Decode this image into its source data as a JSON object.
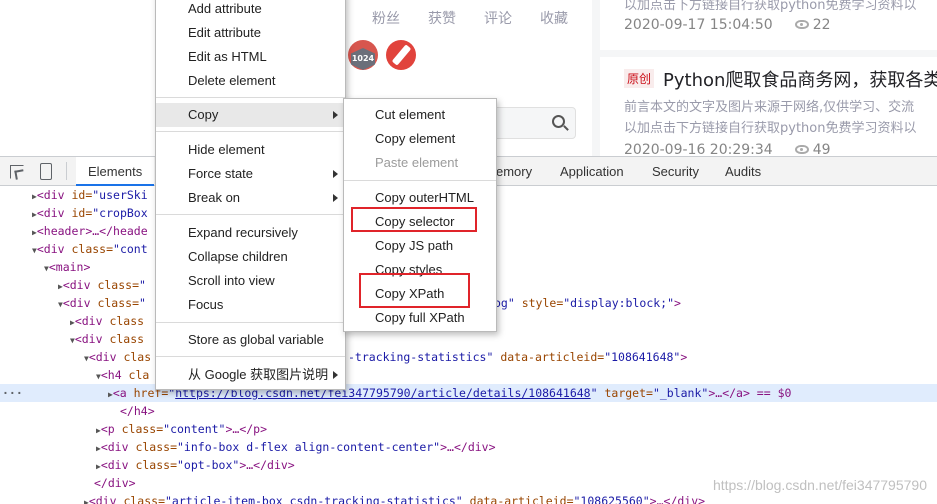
{
  "webpage": {
    "stats": [
      "粉丝",
      "获赞",
      "评论",
      "收藏"
    ],
    "badges": {
      "year_badge": "1024"
    },
    "right_panel": {
      "post1_excerpt": "以加点击下方链接自行获取python免费学习资料以",
      "post1_date": "2020-09-17 15:04:50",
      "post1_views": "22",
      "post2_badge": "原创",
      "post2_title": "Python爬取食品商务网，获取各类",
      "post2_excerpt1": "前言本文的文字及图片来源于网络,仅供学习、交流",
      "post2_excerpt2": "以加点击下方链接自行获取python免费学习资料以",
      "post2_date": "2020-09-16 20:29:34",
      "post2_views": "49"
    }
  },
  "devtools": {
    "tabs": {
      "elements": "Elements",
      "memory": "emory",
      "application": "Application",
      "security": "Security",
      "audits": "Audits"
    },
    "dom": {
      "l1_a": "div",
      "l1_attr": " id=",
      "l1_val": "\"userSki",
      "l2_a": "div",
      "l2_attr": " id=",
      "l2_val": "\"cropBox",
      "l3": "header",
      "l3_rest": "…</heade",
      "l4_a": "div",
      "l4_attr": " class=",
      "l4_val": "\"cont",
      "l5": "main",
      "l6_attr": " class=",
      "l6_val": "\"",
      "l7_attr": " class=",
      "l7_val": "\"",
      "l7_tail_val": "og\"",
      "l7_tail_attr": " style=",
      "l7_tail_val2": "\"display:block;\"",
      "l8_attr": " class",
      "l9_attr": " class",
      "l10_attr": " clas",
      "l10_val": "-tracking-statistics\"",
      "l10_attr2": " data-articleid=",
      "l10_val2": "\"108641648\"",
      "l11_tag": "h4",
      "l11_attr": " cla",
      "l12_tag": "a",
      "l12_attr": " href=",
      "l12_val": "https://blog.csdn.net/fei347795790/article/details/108641648",
      "l12_attr2": " target=",
      "l12_val2": "\"_blank\"",
      "l12_tail": "…</a> == $0",
      "l13": "</h4>",
      "l14_attr": " class=",
      "l14_val": "\"content\"",
      "l14_tail": "…</p>",
      "l15_attr": " class=",
      "l15_val": "\"info-box d-flex align-content-center\"",
      "l15_tail": "…</div>",
      "l16_attr": " class=",
      "l16_val": "\"opt-box\"",
      "l16_tail": "…</div>",
      "l17": "</div>",
      "l18_attr": " class=",
      "l18_val": "\"article-item-box csdn-tracking-statistics\"",
      "l18_attr2": " data-articleid=",
      "l18_val2": "\"108625560\"",
      "l18_tail": "…</div>"
    }
  },
  "context_menu": {
    "items": [
      "Add attribute",
      "Edit attribute",
      "Edit as HTML",
      "Delete element",
      "Copy",
      "Hide element",
      "Force state",
      "Break on",
      "Expand recursively",
      "Collapse children",
      "Scroll into view",
      "Focus",
      "Store as global variable",
      "从 Google 获取图片说明"
    ]
  },
  "copy_submenu": {
    "items": [
      "Cut element",
      "Copy element",
      "Paste element",
      "Copy outerHTML",
      "Copy selector",
      "Copy JS path",
      "Copy styles",
      "Copy XPath",
      "Copy full XPath"
    ]
  },
  "watermark": "https://blog.csdn.net/fei347795790",
  "colors": {
    "highlight_box": "#e0242a",
    "selected_row": "#e0ecfd"
  }
}
